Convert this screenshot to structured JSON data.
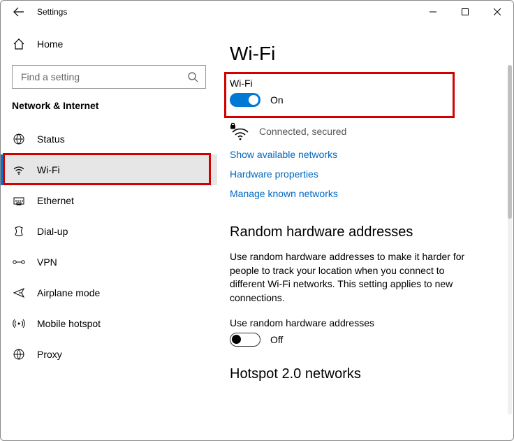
{
  "titlebar": {
    "title": "Settings"
  },
  "sidebar": {
    "home": "Home",
    "search_placeholder": "Find a setting",
    "section": "Network & Internet",
    "items": [
      {
        "label": "Status"
      },
      {
        "label": "Wi-Fi"
      },
      {
        "label": "Ethernet"
      },
      {
        "label": "Dial-up"
      },
      {
        "label": "VPN"
      },
      {
        "label": "Airplane mode"
      },
      {
        "label": "Mobile hotspot"
      },
      {
        "label": "Proxy"
      }
    ]
  },
  "main": {
    "title": "Wi-Fi",
    "wifi_label": "Wi-Fi",
    "wifi_state": "On",
    "connection_status": "Connected, secured",
    "links": {
      "show_networks": "Show available networks",
      "hw_props": "Hardware properties",
      "manage_known": "Manage known networks"
    },
    "random_hw": {
      "title": "Random hardware addresses",
      "body": "Use random hardware addresses to make it harder for people to track your location when you connect to different Wi-Fi networks. This setting applies to new connections.",
      "toggle_label": "Use random hardware addresses",
      "toggle_state": "Off"
    },
    "hotspot20": {
      "title": "Hotspot 2.0 networks"
    }
  }
}
